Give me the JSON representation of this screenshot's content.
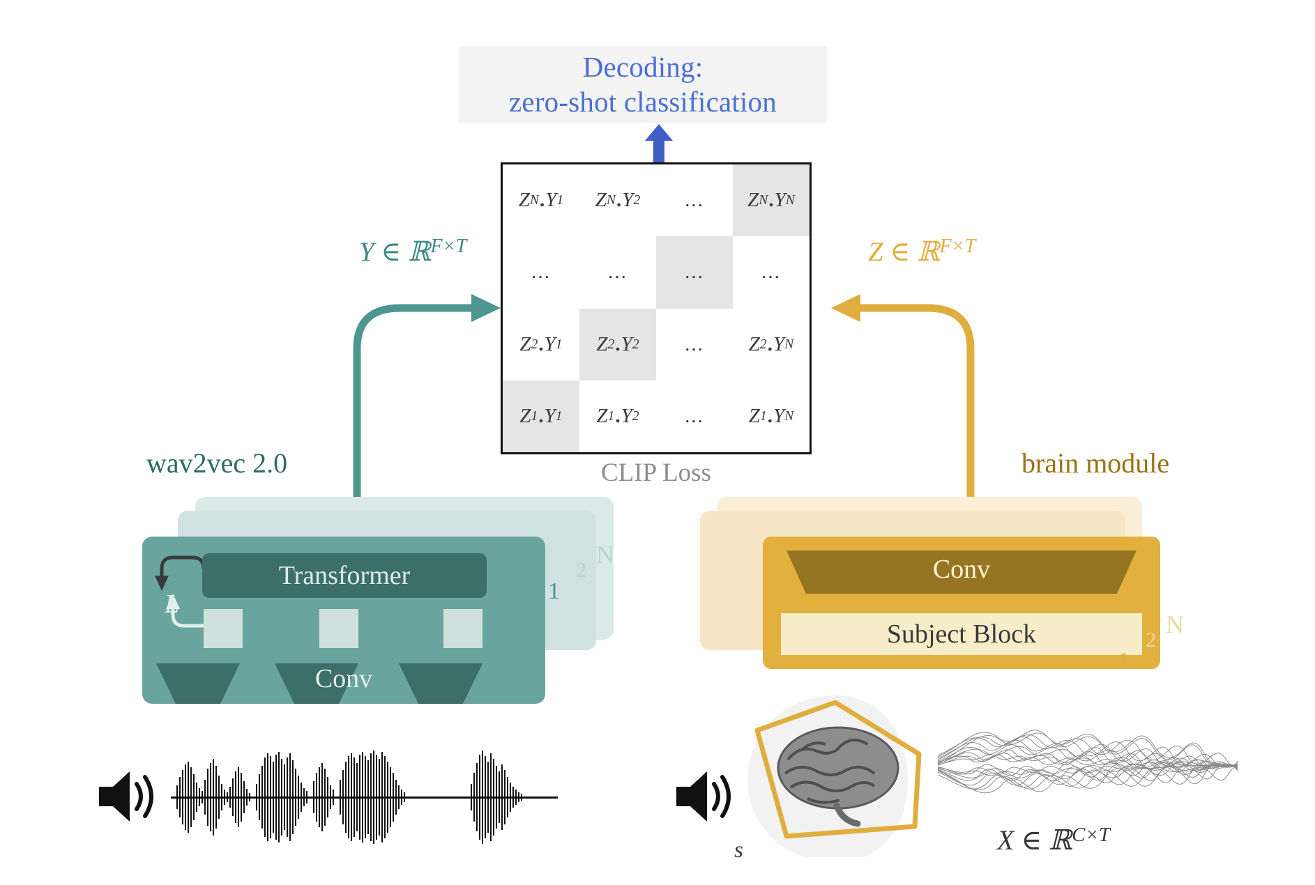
{
  "figure": {
    "domain": "diagram",
    "title_banner": {
      "line1": "Decoding:",
      "line2": "zero-shot classification",
      "color": "#4a6fd0",
      "background": "#f3f3f3"
    },
    "clip_loss_label": "CLIP Loss",
    "matrix": {
      "rows": [
        [
          "Z_N.Y_1",
          "Z_N.Y_2",
          "...",
          "Z_N.Y_N"
        ],
        [
          "...",
          "...",
          "...",
          "..."
        ],
        [
          "Z_2.Y_1",
          "Z_2.Y_2",
          "...",
          "Z_2.Y_N"
        ],
        [
          "Z_1.Y_1",
          "Z_1.Y_2",
          "...",
          "Z_1.Y_N"
        ]
      ],
      "cells": [
        [
          {
            "base_z": "Z",
            "sub_z": "N",
            "base_y": "Y",
            "sub_y": "1",
            "highlight": false
          },
          {
            "base_z": "Z",
            "sub_z": "N",
            "base_y": "Y",
            "sub_y": "2",
            "highlight": false
          },
          {
            "ellipsis": "...",
            "highlight": false
          },
          {
            "base_z": "Z",
            "sub_z": "N",
            "base_y": "Y",
            "sub_y": "N",
            "highlight": true
          }
        ],
        [
          {
            "ellipsis": "...",
            "highlight": false
          },
          {
            "ellipsis": "...",
            "highlight": false
          },
          {
            "ellipsis": "...",
            "highlight": true
          },
          {
            "ellipsis": "...",
            "highlight": false
          }
        ],
        [
          {
            "base_z": "Z",
            "sub_z": "2",
            "base_y": "Y",
            "sub_y": "1",
            "highlight": false
          },
          {
            "base_z": "Z",
            "sub_z": "2",
            "base_y": "Y",
            "sub_y": "2",
            "highlight": true
          },
          {
            "ellipsis": "...",
            "highlight": false
          },
          {
            "base_z": "Z",
            "sub_z": "2",
            "base_y": "Y",
            "sub_y": "N",
            "highlight": false
          }
        ],
        [
          {
            "base_z": "Z",
            "sub_z": "1",
            "base_y": "Y",
            "sub_y": "1",
            "highlight": true
          },
          {
            "base_z": "Z",
            "sub_z": "1",
            "base_y": "Y",
            "sub_y": "2",
            "highlight": false
          },
          {
            "ellipsis": "...",
            "highlight": false
          },
          {
            "base_z": "Z",
            "sub_z": "1",
            "base_y": "Y",
            "sub_y": "N",
            "highlight": false
          }
        ]
      ],
      "highlight_color": "#e5e5e5",
      "border_color": "#111111"
    },
    "annotations": {
      "y_tensor": {
        "symbol": "Y",
        "relation": "∈",
        "space": "ℝ",
        "exponent": "F×T",
        "color": "#3f8a84"
      },
      "z_tensor": {
        "symbol": "Z",
        "relation": "∈",
        "space": "ℝ",
        "exponent": "F×T",
        "color": "#e0ae3e"
      },
      "x_tensor": {
        "symbol": "X",
        "relation": "∈",
        "space": "ℝ",
        "exponent": "C×T",
        "color": "#39393b"
      },
      "subject_letter": "s"
    },
    "speech_module": {
      "title": "wav2vec 2.0",
      "title_color": "#2d6b64",
      "transformer_label": "Transformer",
      "conv_label": "Conv",
      "recurrence_label": "L",
      "layer_labels": [
        "1",
        "2",
        "N"
      ],
      "colors": {
        "card_front": "#6aa49e",
        "card_mid": "#cfe2df",
        "card_back": "#dbe9e7",
        "transformer": "#3c6f69",
        "square": "#cfe0dd"
      }
    },
    "brain_module": {
      "title": "brain module",
      "title_color": "#9a7212",
      "conv_label": "Conv",
      "subject_block_label": "Subject Block",
      "layer_labels": [
        "1",
        "2",
        "N"
      ],
      "colors": {
        "card_front": "#e2b03f",
        "card_mid": "#f7e6c6",
        "card_back": "#faeed7",
        "conv_trapezoid": "#967522",
        "subject_block": "#f7edc9"
      }
    },
    "icons": {
      "speaker_left": "speaker-icon",
      "speaker_right": "speaker-icon",
      "waveform": "audio-waveform",
      "brain": "brain-head-illustration",
      "meg_traces": "meg-signal-traces",
      "up_arrow": "up-arrow-icon"
    }
  }
}
